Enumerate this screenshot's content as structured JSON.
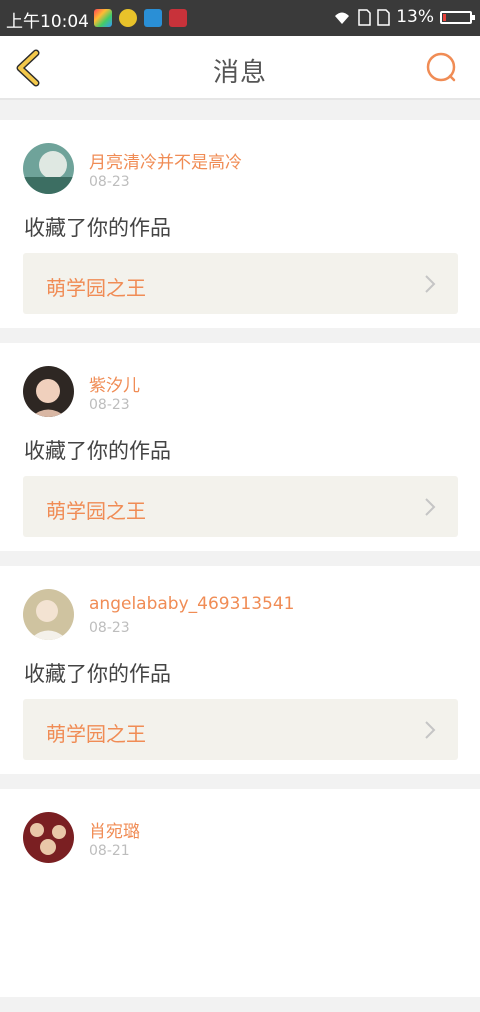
{
  "status_bar": {
    "time": "上午10:04",
    "battery_text": "13%",
    "battery_level": 0.13,
    "apps": [
      "colorful-app-icon",
      "green-app-icon",
      "scanner-app-icon",
      "book-app-icon"
    ]
  },
  "header": {
    "title": "消息",
    "back_icon": "chevron-left-icon",
    "search_icon": "search-icon",
    "accent": "#f08c55",
    "back_color": "#f3c84b"
  },
  "messages": [
    {
      "username": "月亮清冷并不是高冷",
      "date": "08-23",
      "action": "收藏了你的作品",
      "work_title": "萌学园之王"
    },
    {
      "username": "紫汐儿",
      "date": "08-23",
      "action": "收藏了你的作品",
      "work_title": "萌学园之王"
    },
    {
      "username": "angelababy_469313541",
      "date": "08-23",
      "action": "收藏了你的作品",
      "work_title": "萌学园之王"
    },
    {
      "username": "肖宛璐",
      "date": "08-21",
      "action": "",
      "work_title": ""
    }
  ]
}
